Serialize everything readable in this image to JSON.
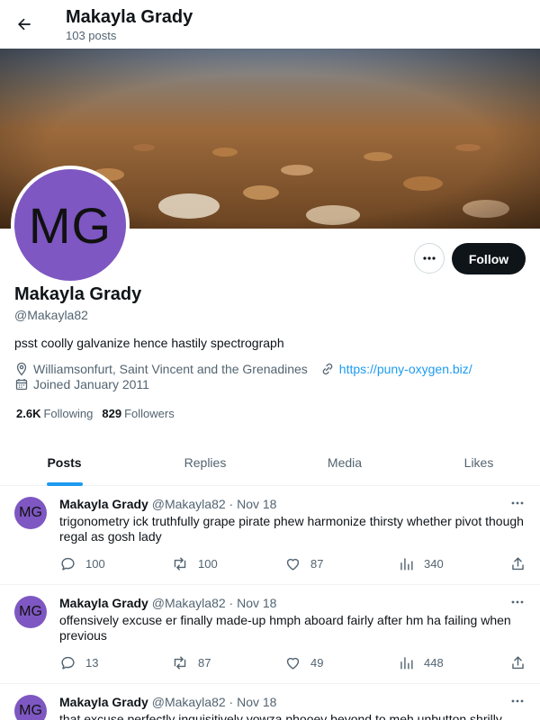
{
  "header": {
    "name": "Makayla Grady",
    "post_count": "103 posts"
  },
  "profile": {
    "avatar_initials": "MG",
    "name": "Makayla Grady",
    "handle": "@Makayla82",
    "bio": "psst coolly galvanize hence hastily spectrograph",
    "location": "Williamsonfurt, Saint Vincent and the Grenadines",
    "website": "https://puny-oxygen.biz/",
    "joined": "Joined January 2011",
    "following_count": "2.6K",
    "following_label": "Following",
    "followers_count": "829",
    "followers_label": "Followers",
    "follow_label": "Follow"
  },
  "tabs": [
    {
      "label": "Posts",
      "active": true
    },
    {
      "label": "Replies",
      "active": false
    },
    {
      "label": "Media",
      "active": false
    },
    {
      "label": "Likes",
      "active": false
    }
  ],
  "posts": [
    {
      "avatar": "MG",
      "name": "Makayla Grady",
      "handle": "@Makayla82",
      "date": "· Nov 18",
      "text": "trigonometry ick truthfully grape pirate phew harmonize thirsty whether pivot though regal as gosh lady",
      "replies": "100",
      "reposts": "100",
      "likes": "87",
      "views": "340"
    },
    {
      "avatar": "MG",
      "name": "Makayla Grady",
      "handle": "@Makayla82",
      "date": "· Nov 18",
      "text": "offensively excuse er finally made-up hmph aboard fairly after hm ha failing when previous",
      "replies": "13",
      "reposts": "87",
      "likes": "49",
      "views": "448"
    },
    {
      "avatar": "MG",
      "name": "Makayla Grady",
      "handle": "@Makayla82",
      "date": "· Nov 18",
      "text": "that excuse perfectly inquisitively yowza phooey beyond to meh unbutton shrilly",
      "replies": "",
      "reposts": "",
      "likes": "",
      "views": ""
    }
  ],
  "colors": {
    "accent": "#1d9bf0",
    "avatar_bg": "#7e57c2",
    "text_primary": "#0f1419",
    "text_secondary": "#536471"
  },
  "icons": {
    "back": "arrow-left-icon",
    "more": "more-horizontal-icon",
    "location": "location-pin-icon",
    "link": "link-icon",
    "calendar": "calendar-icon",
    "reply": "reply-icon",
    "repost": "repost-icon",
    "like": "heart-icon",
    "views": "views-icon",
    "share": "share-icon"
  }
}
